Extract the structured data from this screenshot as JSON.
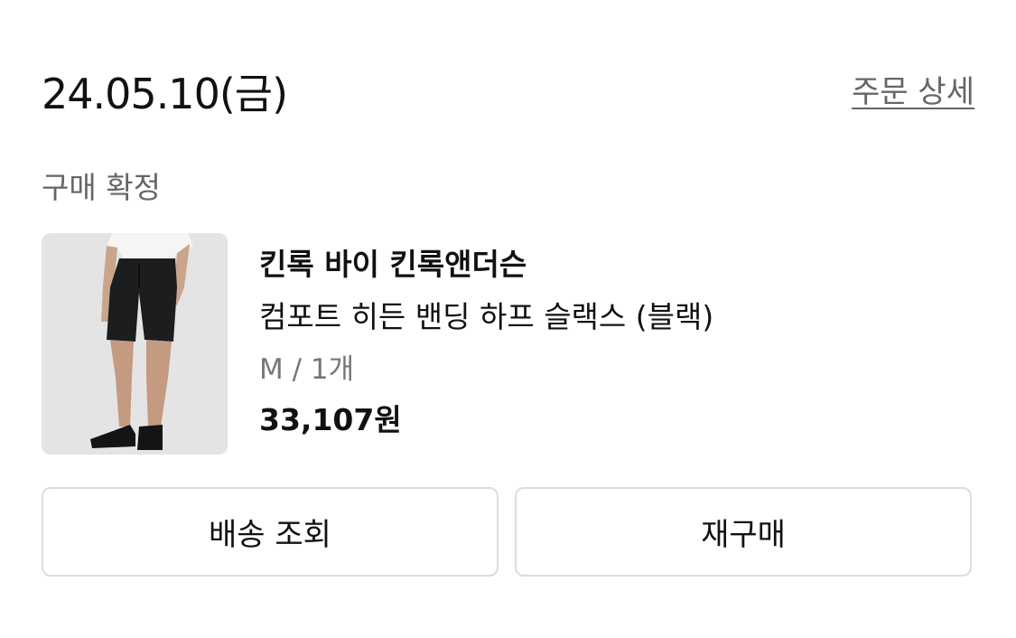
{
  "order": {
    "date": "24.05.10(금)",
    "detail_link": "주문 상세",
    "status": "구매 확정"
  },
  "product": {
    "brand": "킨록 바이 킨록앤더슨",
    "name": "컴포트 히든 밴딩 하프 슬랙스 (블랙)",
    "option": "M / 1개",
    "price": "33,107원",
    "image_icon": "black-shorts-model-photo"
  },
  "actions": {
    "tracking_label": "배송 조회",
    "rebuy_label": "재구매"
  }
}
